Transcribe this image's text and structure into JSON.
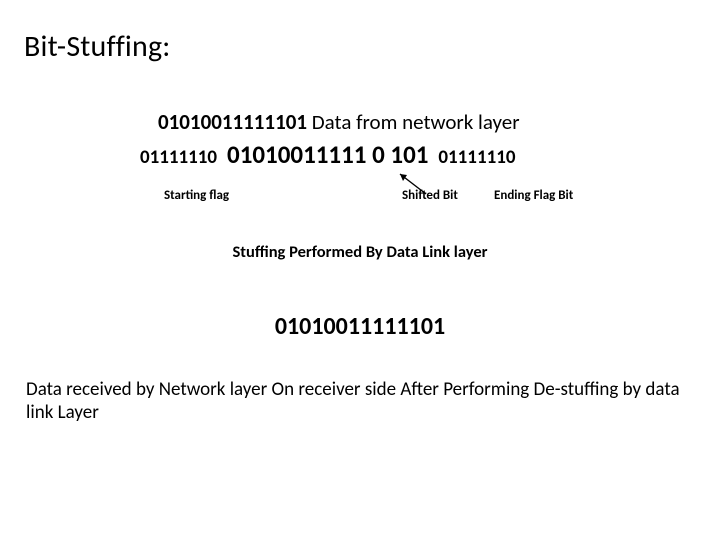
{
  "title": "Bit-Stuffing:",
  "network_layer": {
    "bits": "01010011111101",
    "label": " Data from network layer"
  },
  "stuffed": {
    "start_flag": "01111110",
    "data": "01010011111 0 101",
    "end_flag": "01111110"
  },
  "labels": {
    "starting_flag": "Starting flag",
    "shifted_bit": "Shifted Bit",
    "ending_flag": "Ending Flag Bit"
  },
  "caption_stuffing": "Stuffing Performed  By Data Link layer",
  "result_bits": "01010011111101",
  "caption_destuffing": "Data received by Network layer On receiver side After Performing De-stuffing by data link Layer"
}
